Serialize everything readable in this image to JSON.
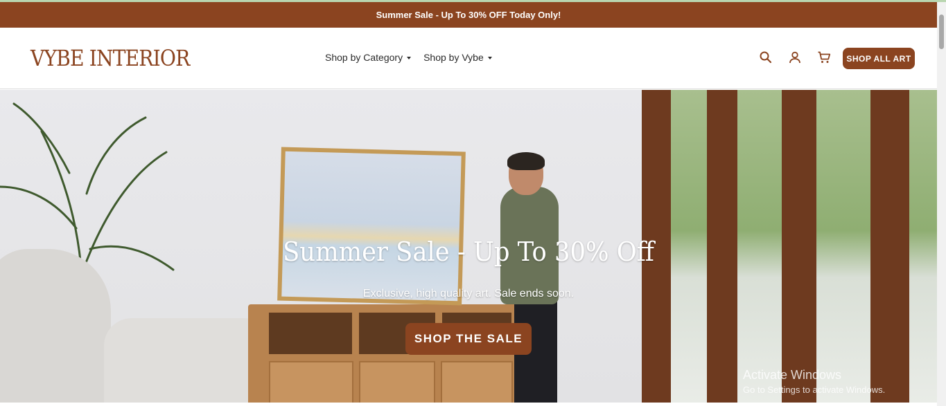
{
  "announcement": {
    "text": "Summer Sale - Up To 30% OFF Today Only!"
  },
  "header": {
    "logo": "VYBE INTERIOR",
    "nav": [
      {
        "label": "Shop by Category"
      },
      {
        "label": "Shop by Vybe"
      }
    ],
    "icons": [
      "search-icon",
      "account-icon",
      "cart-icon"
    ],
    "cta_label": "SHOP ALL ART"
  },
  "hero": {
    "title": "Summer Sale - Up To 30% Off",
    "subtitle": "Exclusive, high quality art. Sale ends soon.",
    "cta_label": "SHOP THE SALE"
  },
  "watermark": {
    "line1": "Activate Windows",
    "line2": "Go to Settings to activate Windows."
  },
  "colors": {
    "brand": "#8b4420",
    "text": "#2a2a2a",
    "white": "#ffffff"
  }
}
